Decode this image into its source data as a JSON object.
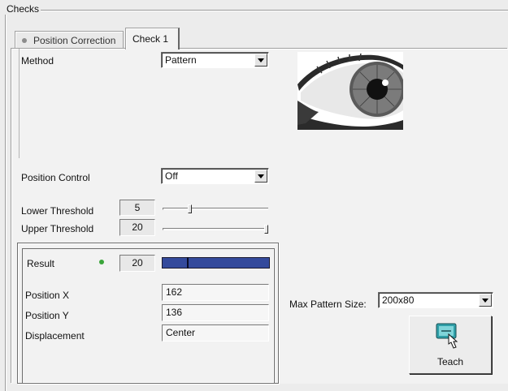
{
  "groupbox": {
    "title": "Checks"
  },
  "tabs": [
    {
      "label": "Position Correction",
      "active": false
    },
    {
      "label": "Check 1",
      "active": true
    }
  ],
  "method": {
    "label": "Method",
    "value": "Pattern"
  },
  "position_control": {
    "label": "Position Control",
    "value": "Off"
  },
  "lower_threshold": {
    "label": "Lower Threshold",
    "value": "5",
    "slider_fraction": 0.27
  },
  "upper_threshold": {
    "label": "Upper Threshold",
    "value": "20",
    "slider_fraction": 1.0
  },
  "result": {
    "label": "Result",
    "value": "20",
    "bar_marker_fraction": 0.23,
    "status_color": "#3aa53a",
    "bar_color": "#344a9c"
  },
  "position_x": {
    "label": "Position X",
    "value": "162"
  },
  "position_y": {
    "label": "Position Y",
    "value": "136"
  },
  "displacement": {
    "label": "Displacement",
    "value": "Center"
  },
  "max_pattern_size": {
    "label": "Max Pattern Size:",
    "value": "200x80"
  },
  "teach": {
    "label": "Teach",
    "icon": "teach-hand-icon"
  },
  "preview": {
    "icon": "eye-pattern-image"
  }
}
